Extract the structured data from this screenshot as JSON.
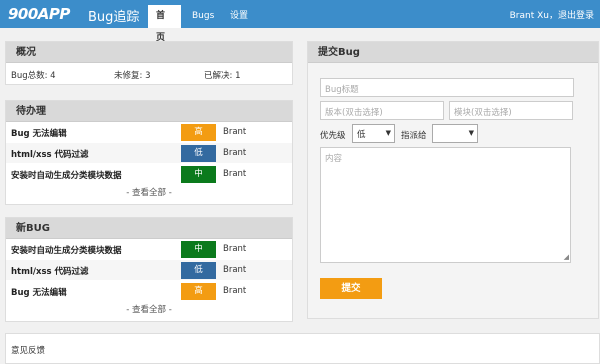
{
  "header": {
    "logo": "900APP",
    "app_name": "Bug追踪",
    "tabs": [
      {
        "label": "首页",
        "active": true
      },
      {
        "label": "Bugs",
        "active": false
      },
      {
        "label": "设置",
        "active": false
      }
    ],
    "user_name": "Brant Xu",
    "separator": "，",
    "logout_label": "退出登录"
  },
  "overview": {
    "title": "概况",
    "total_label": "Bug总数: 4",
    "unfixed_label": "未修复: 3",
    "resolved_label": "已解决: 1"
  },
  "todo": {
    "title": "待办理",
    "items": [
      {
        "title": "Bug 无法编辑",
        "priority": "高",
        "owner": "Brant"
      },
      {
        "title": "html/xss 代码过滤",
        "priority": "低",
        "owner": "Brant"
      },
      {
        "title": "安装时自动生成分类模块数据",
        "priority": "中",
        "owner": "Brant"
      }
    ],
    "more_label": "- 查看全部 -"
  },
  "new_bugs": {
    "title": "新BUG",
    "items": [
      {
        "title": "安装时自动生成分类模块数据",
        "priority": "中",
        "owner": "Brant"
      },
      {
        "title": "html/xss 代码过滤",
        "priority": "低",
        "owner": "Brant"
      },
      {
        "title": "Bug 无法编辑",
        "priority": "高",
        "owner": "Brant"
      }
    ],
    "more_label": "- 查看全部 -"
  },
  "submit": {
    "title": "提交Bug",
    "title_placeholder": "Bug标题",
    "version_placeholder": "版本(双击选择)",
    "module_placeholder": "模块(双击选择)",
    "priority_label": "优先级",
    "priority_value": "低",
    "assign_label": "指派给",
    "assign_value": "",
    "content_placeholder": "内容",
    "submit_label": "提交"
  },
  "footer": {
    "feedback_label": "意见反馈"
  },
  "colors": {
    "header_bg": "#3c8dca",
    "priority_high": "#f39c12",
    "priority_mid": "#0b7a1c",
    "priority_low": "#336aa0",
    "submit_button": "#f39c12"
  }
}
